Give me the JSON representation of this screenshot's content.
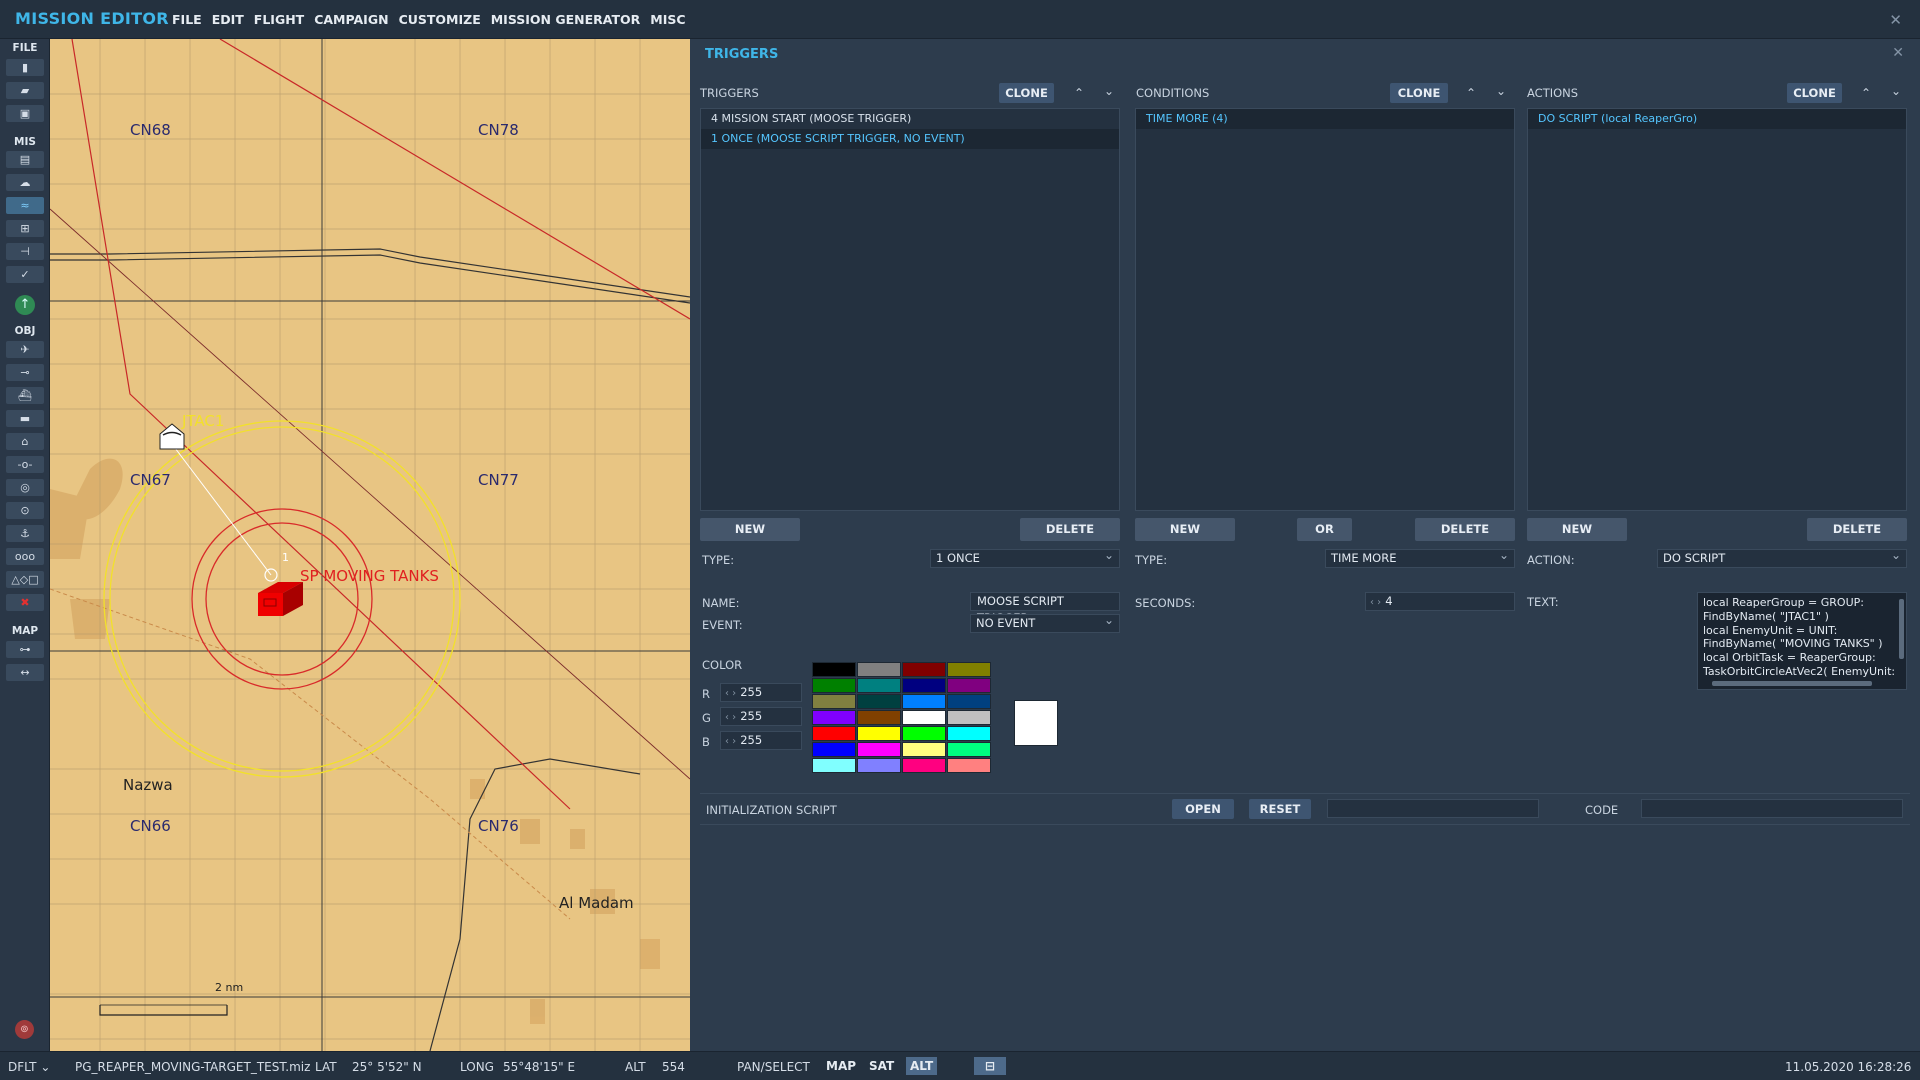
{
  "app": {
    "title": "MISSION EDITOR",
    "menu": [
      "FILE",
      "EDIT",
      "FLIGHT",
      "CAMPAIGN",
      "CUSTOMIZE",
      "MISSION GENERATOR",
      "MISC"
    ]
  },
  "toolbar": {
    "file_label": "FILE",
    "mis_label": "MIS",
    "obj_label": "OBJ",
    "map_label": "MAP"
  },
  "map": {
    "grid_labels": [
      "CN68",
      "CN78",
      "CN67",
      "CN77",
      "CN66",
      "CN76"
    ],
    "places": [
      "Nazwa",
      "Al Madam"
    ],
    "unit_jtac": "JTAC1",
    "unit_tanks": "SP MOVING TANKS",
    "waypoint": "1",
    "scale": "2 nm"
  },
  "panel": {
    "title": "TRIGGERS",
    "triggers": {
      "header": "TRIGGERS",
      "clone": "CLONE",
      "items": [
        "4 MISSION START (MOOSE TRIGGER)",
        "1 ONCE (MOOSE SCRIPT TRIGGER, NO EVENT)"
      ],
      "new": "NEW",
      "delete": "DELETE",
      "type_label": "TYPE:",
      "type_value": "1 ONCE",
      "name_label": "NAME:",
      "name_value": "MOOSE SCRIPT TRIGGER",
      "event_label": "EVENT:",
      "event_value": "NO EVENT",
      "color_label": "COLOR",
      "r_label": "R",
      "r_value": "255",
      "g_label": "G",
      "g_value": "255",
      "b_label": "B",
      "b_value": "255"
    },
    "conditions": {
      "header": "CONDITIONS",
      "clone": "CLONE",
      "items": [
        "TIME MORE (4)"
      ],
      "new": "NEW",
      "or": "OR",
      "delete": "DELETE",
      "type_label": "TYPE:",
      "type_value": "TIME MORE",
      "seconds_label": "SECONDS:",
      "seconds_value": "4"
    },
    "actions": {
      "header": "ACTIONS",
      "clone": "CLONE",
      "items": [
        "DO SCRIPT (local ReaperGro)"
      ],
      "new": "NEW",
      "delete": "DELETE",
      "action_label": "ACTION:",
      "action_value": "DO SCRIPT",
      "text_label": "TEXT:",
      "script_lines": [
        "local ReaperGroup = GROUP:",
        "FindByName( \"JTAC1\" )",
        "local EnemyUnit = UNIT:",
        "FindByName( \"MOVING TANKS\" )",
        "local OrbitTask = ReaperGroup:",
        "TaskOrbitCircleAtVec2( EnemyUnit:"
      ]
    },
    "init": {
      "label": "INITIALIZATION SCRIPT",
      "open": "OPEN",
      "reset": "RESET",
      "code_label": "CODE"
    },
    "palette": [
      "#000000",
      "#808080",
      "#800000",
      "#808000",
      "#008000",
      "#008080",
      "#000080",
      "#800080",
      "#808040",
      "#004040",
      "#0080ff",
      "#004080",
      "#8000ff",
      "#804000",
      "#ffffff",
      "#c0c0c0",
      "#ff0000",
      "#ffff00",
      "#00ff00",
      "#00ffff",
      "#0000ff",
      "#ff00ff",
      "#ffff80",
      "#00ff80",
      "#80ffff",
      "#8080ff",
      "#ff0080",
      "#ff8080"
    ],
    "swatch_color": "#ffffff"
  },
  "status": {
    "profile": "DFLT",
    "file": "PG_REAPER_MOVING-TARGET_TEST.miz",
    "lat_label": "LAT",
    "lat_value": "25° 5'52\" N",
    "long_label": "LONG",
    "long_value": "55°48'15\" E",
    "alt_label": "ALT",
    "alt_value": "554",
    "pan_select": "PAN/SELECT",
    "map_btn": "MAP",
    "sat_btn": "SAT",
    "alt_btn": "ALT",
    "datetime": "11.05.2020 16:28:26"
  }
}
